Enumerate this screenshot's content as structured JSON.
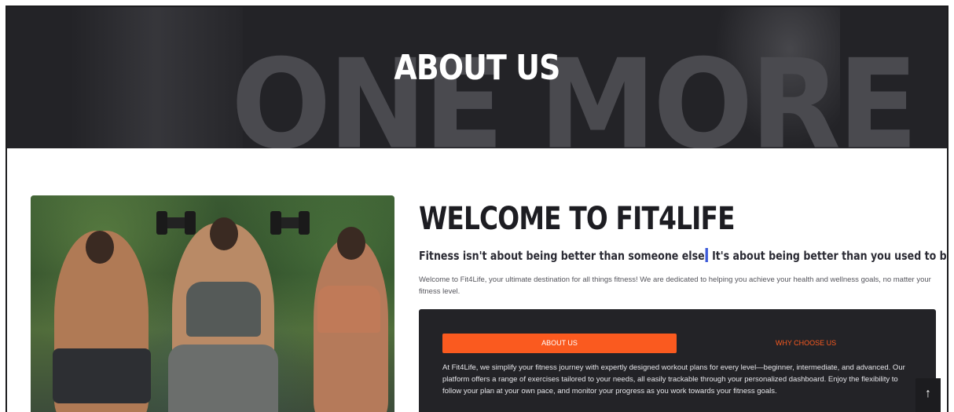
{
  "hero": {
    "title": "ABOUT US",
    "background_text": "ONE MORE"
  },
  "about": {
    "title": "WELCOME TO FIT4LIFE",
    "tagline_part1": "Fitness isn't about being better than someone else",
    "tagline_part2": " It's about being better than you used to be",
    "intro": "Welcome to Fit4Life, your ultimate destination for all things fitness! We are dedicated to helping you achieve your health and wellness goals, no matter your fitness level."
  },
  "tabs": [
    {
      "label": "ABOUT US",
      "active": true
    },
    {
      "label": "WHY CHOOSE US",
      "active": false
    }
  ],
  "panel": {
    "text": "At Fit4Life, we simplify your fitness journey with expertly designed workout plans for every level—beginner, intermediate, and advanced. Our platform offers a range of exercises tailored to your needs, all easily trackable through your personalized dashboard. Enjoy the flexibility to follow your plan at your own pace, and monitor your progress as you work towards your fitness goals."
  },
  "scroll_top": {
    "icon": "arrow-up-icon",
    "glyph": "↑"
  },
  "colors": {
    "accent": "#fa5a1f",
    "dark": "#232327",
    "text": "#1d1d22"
  }
}
